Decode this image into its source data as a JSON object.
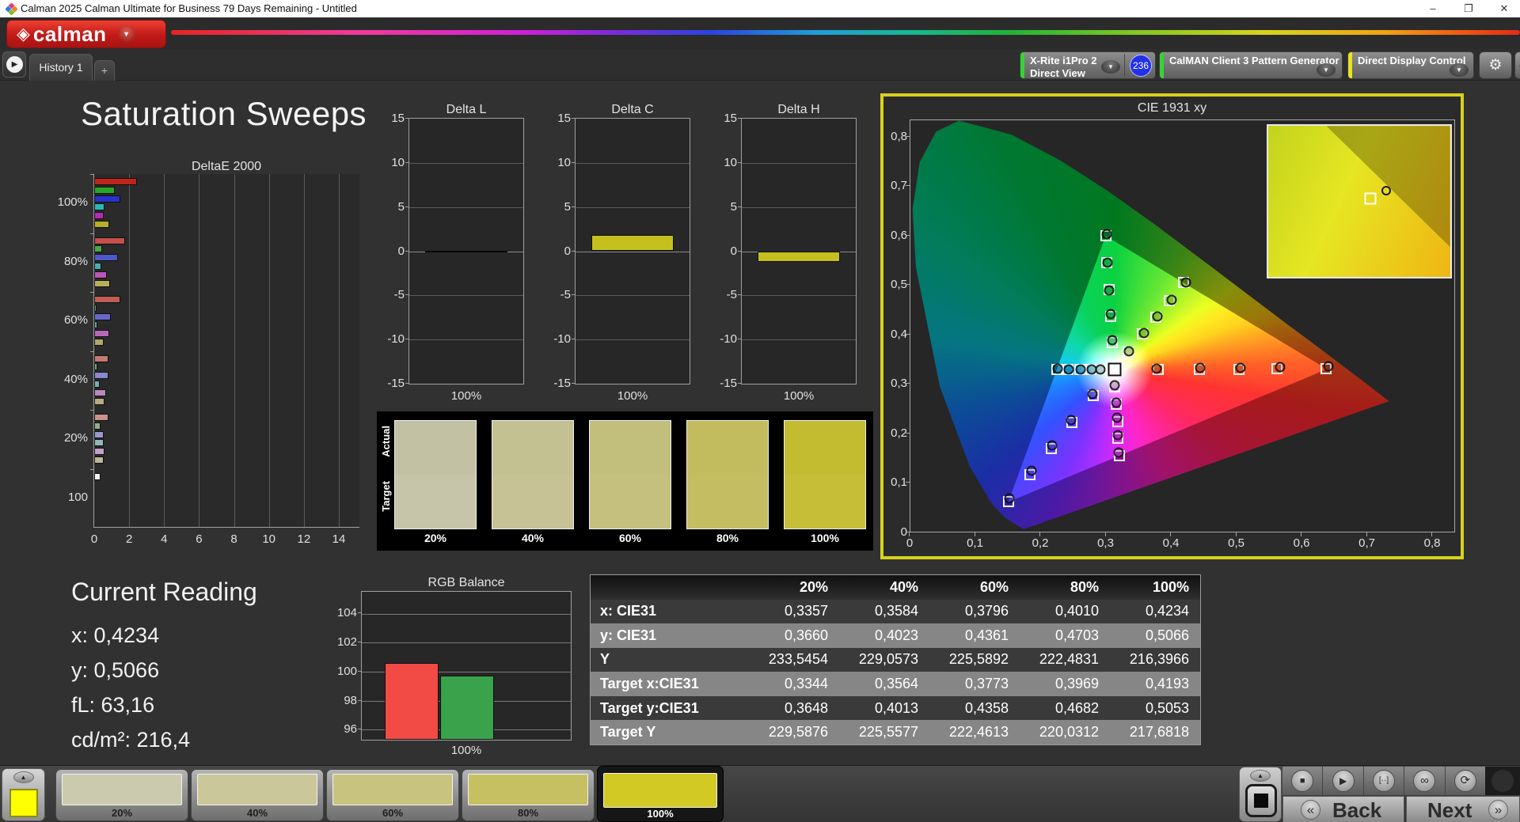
{
  "window": {
    "title": "Calman 2025 Calman Ultimate for Business 79 Days Remaining  - Untitled",
    "minimize": "–",
    "restore": "❐",
    "close": "✕"
  },
  "brand": {
    "word": "calman",
    "logo_glyph": "◈"
  },
  "tabs": {
    "history": "History 1",
    "add": "+"
  },
  "toolbar": {
    "meter": {
      "line1": "X-Rite i1Pro 2",
      "line2": "Direct View",
      "badge": "236",
      "accent": "#35d435"
    },
    "pattern": {
      "label": "CalMAN Client 3 Pattern Generator",
      "accent": "#35d435"
    },
    "display": {
      "label": "Direct Display Control",
      "accent": "#e8e41f"
    },
    "gear_icon": "⚙",
    "collapse_icon": "◀"
  },
  "page": {
    "title": "Saturation Sweeps"
  },
  "current_reading": {
    "title": "Current Reading",
    "lines": [
      "x: 0,4234",
      "y: 0,5066",
      "fL: 63,16",
      "cd/m²: 216,4"
    ]
  },
  "footer": {
    "swatches": [
      {
        "label": "20%",
        "color": "#cbcaae",
        "selected": false
      },
      {
        "label": "40%",
        "color": "#cac79a",
        "selected": false
      },
      {
        "label": "60%",
        "color": "#c8c480",
        "selected": false
      },
      {
        "label": "80%",
        "color": "#c6c062",
        "selected": false
      },
      {
        "label": "100%",
        "color": "#d2c924",
        "selected": true
      }
    ],
    "controls": {
      "stop": "■",
      "play": "▶",
      "single": "[··]",
      "continuous": "∞",
      "refresh": "⟳"
    },
    "back": "Back",
    "next": "Next",
    "back_icon": "«",
    "next_icon": "»"
  },
  "chart_data": {
    "deltaE2000": {
      "type": "bar",
      "title": "DeltaE 2000",
      "xlim": [
        0,
        14
      ],
      "xticks": [
        0,
        2,
        4,
        6,
        8,
        10,
        12,
        14
      ],
      "groups": [
        {
          "label": "100%",
          "values": [
            2.45,
            1.2,
            1.5,
            0.6,
            0.55,
            0.85
          ],
          "colors": [
            "#c2241c",
            "#28a828",
            "#2832c8",
            "#28b8b8",
            "#b828b8",
            "#b8b028"
          ]
        },
        {
          "label": "80%",
          "values": [
            1.77,
            0.45,
            1.35,
            0.4,
            0.74,
            0.9
          ],
          "colors": [
            "#c4504a",
            "#48a848",
            "#5058c8",
            "#48b0b0",
            "#b858b8",
            "#b8b058"
          ]
        },
        {
          "label": "60%",
          "values": [
            1.5,
            0.15,
            0.95,
            0.2,
            0.86,
            0.53
          ],
          "colors": [
            "#c05e56",
            "#60a860",
            "#6868c8",
            "#60a8a8",
            "#b868b8",
            "#b0a868"
          ]
        },
        {
          "label": "40%",
          "values": [
            0.82,
            0.18,
            0.83,
            0.33,
            0.67,
            0.59
          ],
          "colors": [
            "#c27a72",
            "#78a878",
            "#8888cc",
            "#78b0b0",
            "#bc88bc",
            "#b4ac80"
          ]
        },
        {
          "label": "20%",
          "values": [
            0.83,
            0.38,
            0.56,
            0.56,
            0.6,
            0.56
          ],
          "colors": [
            "#c8928a",
            "#90b090",
            "#9898cc",
            "#90b8b8",
            "#c4a0c4",
            "#bcb49c"
          ]
        },
        {
          "label": "100",
          "values": [
            0.35
          ],
          "colors": [
            "#f2f2f2"
          ]
        }
      ]
    },
    "delta_charts": {
      "type": "bar",
      "ylim": [
        -15,
        15
      ],
      "yticks": [
        15,
        10,
        5,
        0,
        -5,
        -10,
        -15
      ],
      "bar_color": "#c6c01e",
      "charts": [
        {
          "title": "Delta L",
          "xlabel": "100%",
          "value": 0.0
        },
        {
          "title": "Delta C",
          "xlabel": "100%",
          "value": 1.8
        },
        {
          "title": "Delta H",
          "xlabel": "100%",
          "value": -1.2
        }
      ]
    },
    "swatch_strip": {
      "row_labels": [
        "Actual",
        "Target"
      ],
      "labels": [
        "20%",
        "40%",
        "60%",
        "80%",
        "100%"
      ],
      "actual_colors": [
        "#c2c1a4",
        "#c3c092",
        "#c2be7b",
        "#c2bc5e",
        "#c3bc30"
      ],
      "target_colors": [
        "#c6c5a9",
        "#c6c296",
        "#c5c07e",
        "#c4bd62",
        "#c5be36"
      ]
    },
    "rgb_balance": {
      "type": "bar",
      "title": "RGB Balance",
      "xlabel": "100%",
      "ylim": [
        95.3,
        105.5
      ],
      "yticks": [
        104,
        102,
        100,
        98,
        96
      ],
      "bars": [
        {
          "name": "red",
          "value": 100.6,
          "color": "#f24a45"
        },
        {
          "name": "green",
          "value": 99.7,
          "color": "#3aa24b"
        }
      ]
    },
    "cie": {
      "type": "scatter",
      "title": "CIE 1931 xy",
      "xlim": [
        0,
        0.835
      ],
      "ylim": [
        0,
        0.835
      ],
      "xticks": [
        "0",
        "0,1",
        "0,2",
        "0,3",
        "0,4",
        "0,5",
        "0,6",
        "0,7",
        "0,8"
      ],
      "yticks": [
        "0,8",
        "0,7",
        "0,6",
        "0,5",
        "0,4",
        "0,3",
        "0,2",
        "0,1",
        "0"
      ],
      "white_point": {
        "x": 0.313,
        "y": 0.329
      },
      "sweeps": [
        {
          "name": "red",
          "measured": [
            [
              0.378,
              0.331
            ],
            [
              0.445,
              0.332
            ],
            [
              0.507,
              0.333
            ],
            [
              0.567,
              0.334
            ],
            [
              0.642,
              0.336
            ]
          ],
          "targets": [
            [
              0.38,
              0.329
            ],
            [
              0.444,
              0.329
            ],
            [
              0.505,
              0.329
            ],
            [
              0.563,
              0.33
            ],
            [
              0.638,
              0.33
            ]
          ]
        },
        {
          "name": "green",
          "measured": [
            [
              0.31,
              0.388
            ],
            [
              0.307,
              0.441
            ],
            [
              0.305,
              0.489
            ],
            [
              0.303,
              0.546
            ],
            [
              0.301,
              0.603
            ]
          ],
          "targets": [
            [
              0.31,
              0.383
            ],
            [
              0.307,
              0.437
            ],
            [
              0.305,
              0.492
            ],
            [
              0.302,
              0.546
            ],
            [
              0.3,
              0.6
            ]
          ]
        },
        {
          "name": "blue",
          "measured": [
            [
              0.28,
              0.28
            ],
            [
              0.247,
              0.226
            ],
            [
              0.218,
              0.175
            ],
            [
              0.186,
              0.123
            ],
            [
              0.152,
              0.067
            ]
          ],
          "targets": [
            [
              0.281,
              0.276
            ],
            [
              0.248,
              0.222
            ],
            [
              0.216,
              0.168
            ],
            [
              0.184,
              0.115
            ],
            [
              0.151,
              0.061
            ]
          ]
        },
        {
          "name": "cyan",
          "measured": [
            [
              0.292,
              0.329
            ],
            [
              0.278,
              0.329
            ],
            [
              0.261,
              0.329
            ],
            [
              0.243,
              0.329
            ],
            [
              0.226,
              0.33
            ]
          ],
          "targets": [
            [
              0.295,
              0.329
            ],
            [
              0.277,
              0.329
            ],
            [
              0.26,
              0.329
            ],
            [
              0.242,
              0.329
            ],
            [
              0.225,
              0.329
            ]
          ]
        },
        {
          "name": "magenta",
          "measured": [
            [
              0.314,
              0.297
            ],
            [
              0.316,
              0.262
            ],
            [
              0.317,
              0.231
            ],
            [
              0.319,
              0.196
            ],
            [
              0.32,
              0.16
            ]
          ],
          "targets": [
            [
              0.314,
              0.294
            ],
            [
              0.316,
              0.259
            ],
            [
              0.318,
              0.224
            ],
            [
              0.319,
              0.189
            ],
            [
              0.321,
              0.154
            ]
          ]
        },
        {
          "name": "yellow",
          "measured": [
            [
              0.3357,
              0.366
            ],
            [
              0.3584,
              0.4023
            ],
            [
              0.3796,
              0.4361
            ],
            [
              0.401,
              0.4703
            ],
            [
              0.4234,
              0.5066
            ]
          ],
          "targets": [
            [
              0.3344,
              0.3648
            ],
            [
              0.3564,
              0.4013
            ],
            [
              0.3773,
              0.4358
            ],
            [
              0.3969,
              0.4682
            ],
            [
              0.4193,
              0.5053
            ]
          ]
        }
      ]
    },
    "table": {
      "type": "table",
      "columns": [
        "20%",
        "40%",
        "60%",
        "80%",
        "100%"
      ],
      "rows": [
        {
          "label": "x: CIE31",
          "shade": "dark",
          "values": [
            "0,3357",
            "0,3584",
            "0,3796",
            "0,4010",
            "0,4234"
          ]
        },
        {
          "label": "y: CIE31",
          "shade": "light",
          "values": [
            "0,3660",
            "0,4023",
            "0,4361",
            "0,4703",
            "0,5066"
          ]
        },
        {
          "label": "Y",
          "shade": "dark",
          "values": [
            "233,5454",
            "229,0573",
            "225,5892",
            "222,4831",
            "216,3966"
          ]
        },
        {
          "label": "Target x:CIE31",
          "shade": "light",
          "values": [
            "0,3344",
            "0,3564",
            "0,3773",
            "0,3969",
            "0,4193"
          ]
        },
        {
          "label": "Target y:CIE31",
          "shade": "dark",
          "values": [
            "0,3648",
            "0,4013",
            "0,4358",
            "0,4682",
            "0,5053"
          ]
        },
        {
          "label": "Target Y",
          "shade": "light",
          "values": [
            "229,5876",
            "225,5577",
            "222,4613",
            "220,0312",
            "217,6818"
          ]
        }
      ]
    }
  }
}
